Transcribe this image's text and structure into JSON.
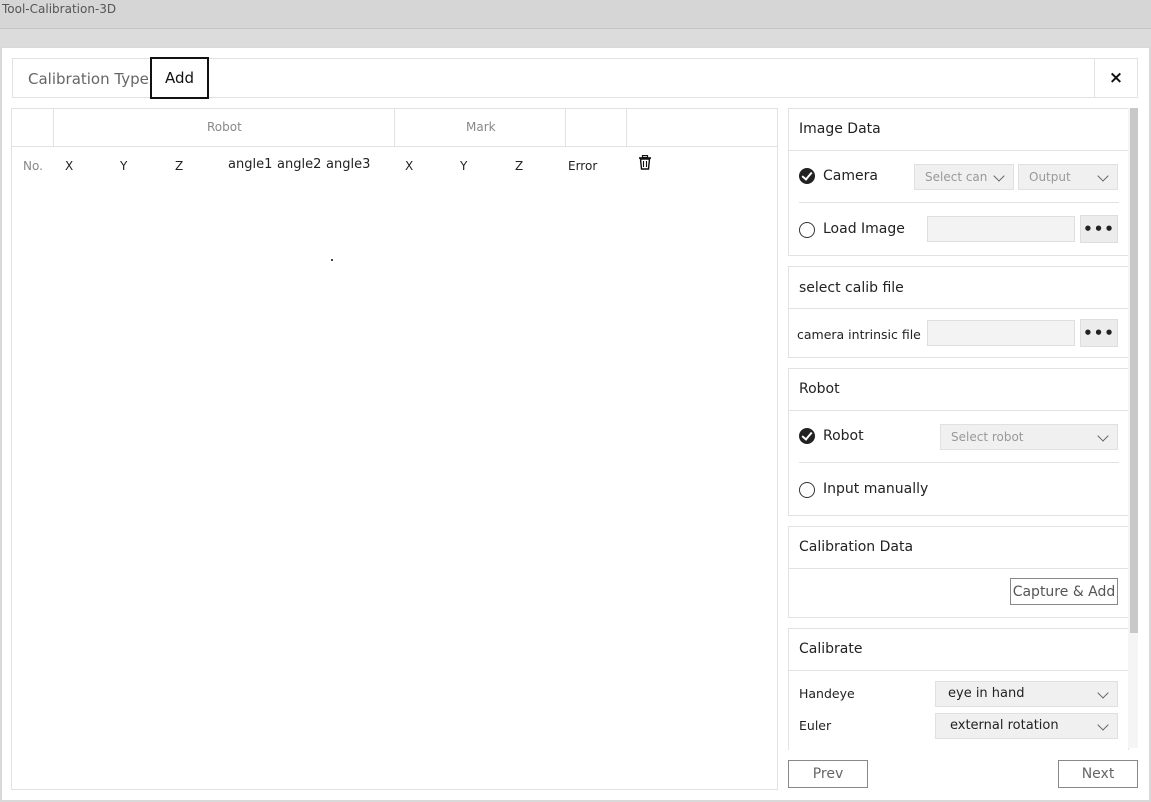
{
  "window": {
    "title": "Tool-Calibration-3D"
  },
  "tabs": {
    "calibration_type": "Calibration Type",
    "add": "Add",
    "close": "×"
  },
  "table": {
    "groups": {
      "robot": "Robot",
      "mark": "Mark"
    },
    "columns": [
      "No.",
      "X",
      "Y",
      "Z",
      "angle1",
      "angle2",
      "angle3",
      "X",
      "Y",
      "Z",
      "Error"
    ]
  },
  "image_data": {
    "title": "Image Data",
    "camera_label": "Camera",
    "camera_select": "Select can",
    "output_select": "Output",
    "load_image_label": "Load Image",
    "dots": "•••"
  },
  "calib_file": {
    "title": "select calib file",
    "intrinsic_label": "camera intrinsic file",
    "dots": "•••"
  },
  "robot": {
    "title": "Robot",
    "robot_label": "Robot",
    "robot_select": "Select robot",
    "manual_label": "Input manually"
  },
  "calibration_data": {
    "title": "Calibration Data",
    "capture_button": "Capture & Add"
  },
  "calibrate": {
    "title": "Calibrate",
    "handeye_label": "Handeye",
    "handeye_value": "eye in hand",
    "euler_label": "Euler",
    "euler_value": "external rotation"
  },
  "footer": {
    "prev": "Prev",
    "next": "Next"
  }
}
